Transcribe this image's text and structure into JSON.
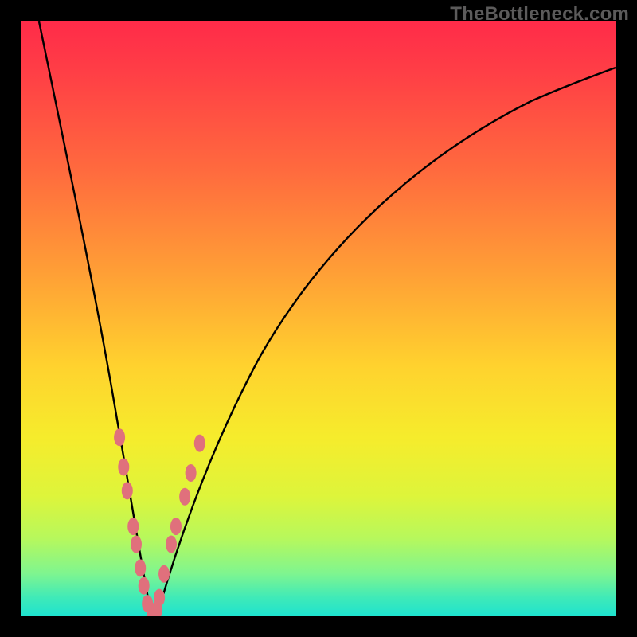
{
  "watermark": "TheBottleneck.com",
  "chart_data": {
    "type": "line",
    "title": "",
    "xlabel": "",
    "ylabel": "",
    "xlim": [
      0,
      100
    ],
    "ylim": [
      0,
      100
    ],
    "curve": {
      "name": "bottleneck-curve",
      "type": "v-curve",
      "x": [
        3,
        5,
        8,
        11,
        14,
        16,
        18,
        19,
        20,
        21,
        22,
        23,
        25,
        27,
        30,
        35,
        40,
        50,
        60,
        70,
        80,
        90,
        100
      ],
      "y": [
        100,
        90,
        75,
        60,
        45,
        33,
        22,
        14,
        8,
        3,
        0,
        3,
        10,
        18,
        28,
        40,
        49,
        62,
        71,
        78,
        83,
        87,
        90
      ]
    },
    "min_point": {
      "x": 22,
      "y": 0
    },
    "beads": {
      "left_arm": [
        {
          "x": 16.5,
          "y": 30
        },
        {
          "x": 17.2,
          "y": 25
        },
        {
          "x": 17.8,
          "y": 21
        },
        {
          "x": 18.8,
          "y": 15
        },
        {
          "x": 19.3,
          "y": 12
        },
        {
          "x": 20.0,
          "y": 8
        },
        {
          "x": 20.6,
          "y": 5
        }
      ],
      "right_arm": [
        {
          "x": 23.2,
          "y": 3
        },
        {
          "x": 24.0,
          "y": 7
        },
        {
          "x": 25.2,
          "y": 12
        },
        {
          "x": 26.0,
          "y": 15
        },
        {
          "x": 27.5,
          "y": 20
        },
        {
          "x": 28.5,
          "y": 24
        },
        {
          "x": 30.0,
          "y": 29
        }
      ],
      "bottom": [
        {
          "x": 21.2,
          "y": 2
        },
        {
          "x": 22.0,
          "y": 0.5
        },
        {
          "x": 22.8,
          "y": 1
        }
      ]
    },
    "gradient_stops": [
      {
        "pos": 0,
        "color": "#ff2b49"
      },
      {
        "pos": 50,
        "color": "#ffd22e"
      },
      {
        "pos": 100,
        "color": "#1fe3cf"
      }
    ]
  }
}
